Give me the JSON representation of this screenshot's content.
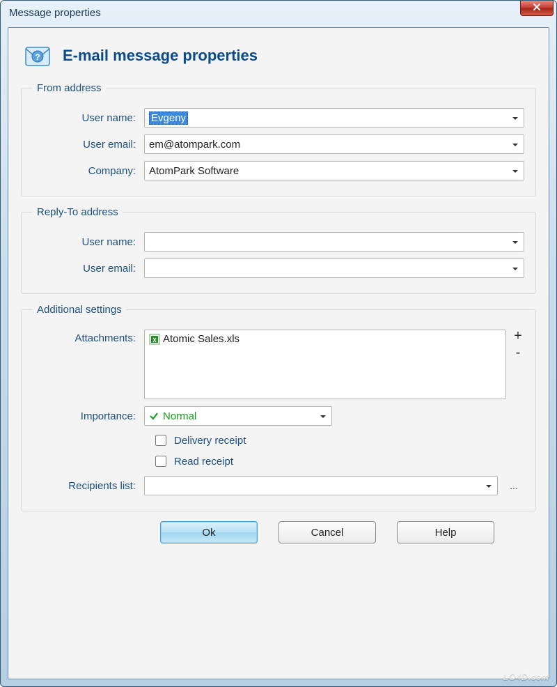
{
  "window": {
    "title": "Message properties"
  },
  "header": {
    "title": "E-mail message properties"
  },
  "groups": {
    "from": {
      "legend": "From address",
      "user_name_label": "User name:",
      "user_name_value": "Evgeny",
      "user_email_label": "User email:",
      "user_email_value": "em@atompark.com",
      "company_label": "Company:",
      "company_value": "AtomPark Software"
    },
    "reply": {
      "legend": "Reply-To address",
      "user_name_label": "User name:",
      "user_name_value": "",
      "user_email_label": "User email:",
      "user_email_value": ""
    },
    "additional": {
      "legend": "Additional settings",
      "attachments_label": "Attachments:",
      "attachments": [
        "Atomic Sales.xls"
      ],
      "add_symbol": "+",
      "remove_symbol": "-",
      "importance_label": "Importance:",
      "importance_value": "Normal",
      "delivery_receipt_label": "Delivery receipt",
      "delivery_receipt_checked": false,
      "read_receipt_label": "Read receipt",
      "read_receipt_checked": false,
      "recipients_label": "Recipients list:",
      "recipients_value": "",
      "ellipsis": "..."
    }
  },
  "buttons": {
    "ok": "Ok",
    "cancel": "Cancel",
    "help": "Help"
  },
  "watermark": "LO4D.com"
}
